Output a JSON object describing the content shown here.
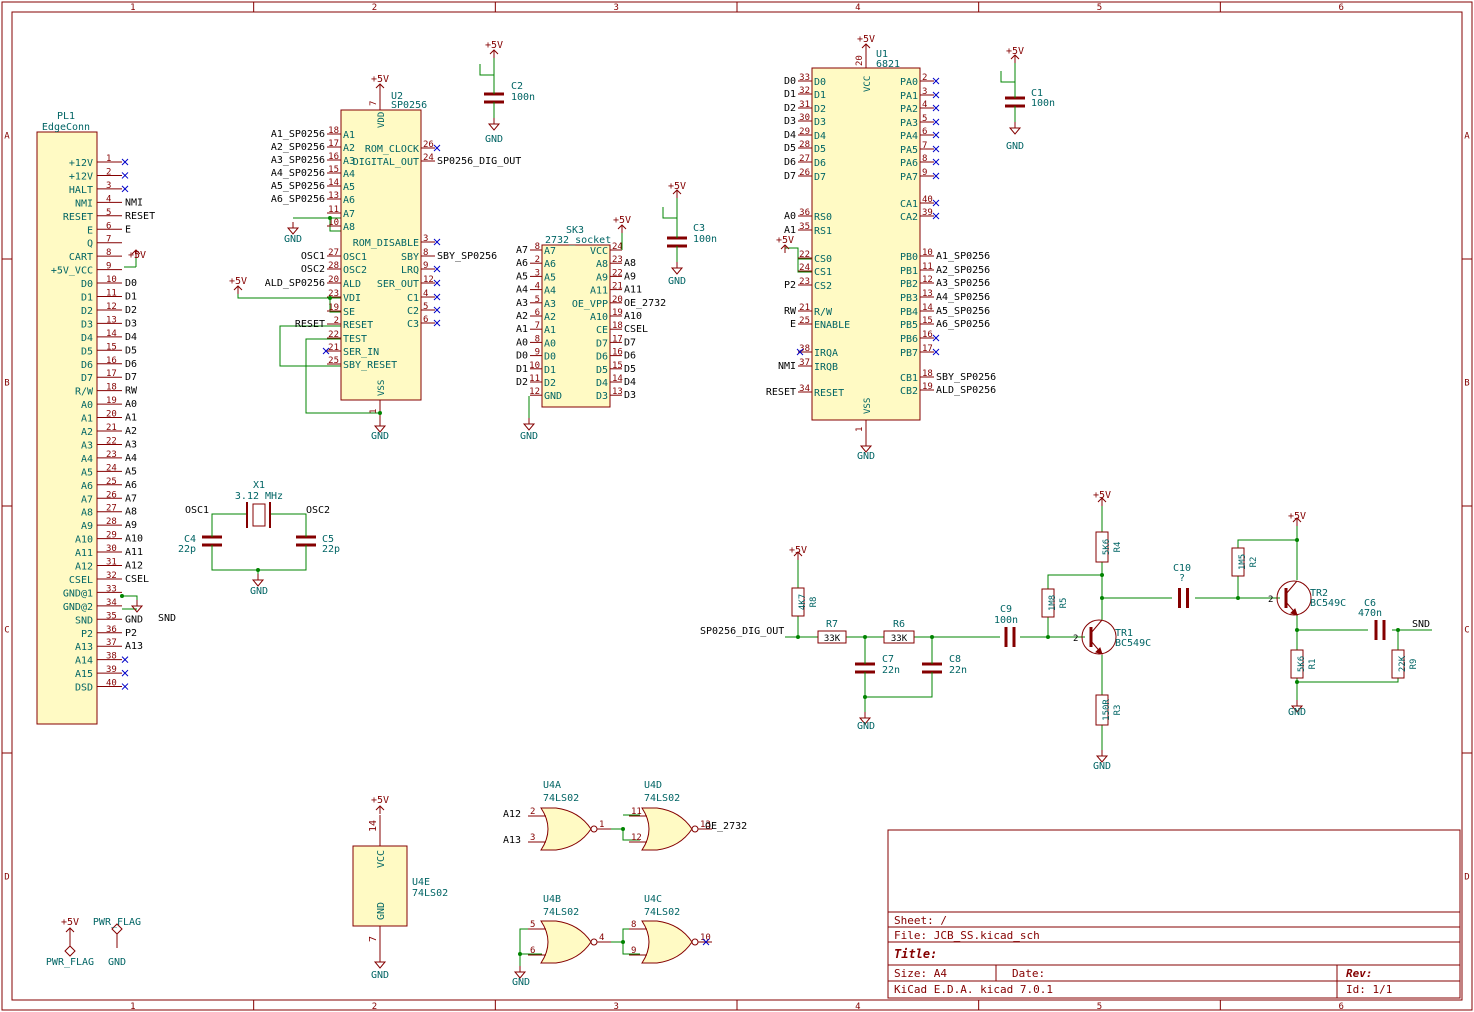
{
  "frame": {
    "col_labels": [
      "1",
      "2",
      "3",
      "4",
      "5",
      "6"
    ],
    "row_labels": [
      "A",
      "B",
      "C",
      "D"
    ]
  },
  "colors": {
    "frame": "#840000",
    "body": "#fffac4",
    "wire": "#008400",
    "text": "#000000",
    "power": "#840000",
    "ref": "#006464",
    "noconnect": "#0000c8"
  },
  "title_block": {
    "sheet": "Sheet: /",
    "file": "File: JCB_SS.kicad_sch",
    "title": "Title:",
    "size": "Size: A4",
    "date": "Date:",
    "rev": "Rev:",
    "kicad": "KiCad E.D.A.  kicad 7.0.1",
    "id": "Id: 1/1"
  },
  "pl1": {
    "ref": "PL1",
    "value": "EdgeConn",
    "pins": [
      {
        "num": "1",
        "name": "+12V",
        "net": ""
      },
      {
        "num": "2",
        "name": "+12V",
        "net": ""
      },
      {
        "num": "3",
        "name": "HALT",
        "net": ""
      },
      {
        "num": "4",
        "name": "NMI",
        "net": "NMI"
      },
      {
        "num": "5",
        "name": "RESET",
        "net": "RESET"
      },
      {
        "num": "6",
        "name": "E",
        "net": "E"
      },
      {
        "num": "7",
        "name": "Q",
        "net": ""
      },
      {
        "num": "8",
        "name": "CART",
        "net": ""
      },
      {
        "num": "9",
        "name": "+5V_VCC",
        "net": ""
      },
      {
        "num": "10",
        "name": "D0",
        "net": "D0"
      },
      {
        "num": "11",
        "name": "D1",
        "net": "D1"
      },
      {
        "num": "12",
        "name": "D2",
        "net": "D2"
      },
      {
        "num": "13",
        "name": "D3",
        "net": "D3"
      },
      {
        "num": "14",
        "name": "D4",
        "net": "D4"
      },
      {
        "num": "15",
        "name": "D5",
        "net": "D5"
      },
      {
        "num": "16",
        "name": "D6",
        "net": "D6"
      },
      {
        "num": "17",
        "name": "D7",
        "net": "D7"
      },
      {
        "num": "18",
        "name": "R/W",
        "net": "RW"
      },
      {
        "num": "19",
        "name": "A0",
        "net": "A0"
      },
      {
        "num": "20",
        "name": "A1",
        "net": "A1"
      },
      {
        "num": "21",
        "name": "A2",
        "net": "A2"
      },
      {
        "num": "22",
        "name": "A3",
        "net": "A3"
      },
      {
        "num": "23",
        "name": "A4",
        "net": "A4"
      },
      {
        "num": "24",
        "name": "A5",
        "net": "A5"
      },
      {
        "num": "25",
        "name": "A6",
        "net": "A6"
      },
      {
        "num": "26",
        "name": "A7",
        "net": "A7"
      },
      {
        "num": "27",
        "name": "A8",
        "net": "A8"
      },
      {
        "num": "28",
        "name": "A9",
        "net": "A9"
      },
      {
        "num": "29",
        "name": "A10",
        "net": "A10"
      },
      {
        "num": "30",
        "name": "A11",
        "net": "A11"
      },
      {
        "num": "31",
        "name": "A12",
        "net": "A12"
      },
      {
        "num": "32",
        "name": "CSEL",
        "net": "CSEL"
      },
      {
        "num": "33",
        "name": "GND@1",
        "net": ""
      },
      {
        "num": "34",
        "name": "GND@2",
        "net": ""
      },
      {
        "num": "35",
        "name": "SND",
        "net": "GND"
      },
      {
        "num": "36",
        "name": "P2",
        "net": "P2"
      },
      {
        "num": "37",
        "name": "A13",
        "net": "A13"
      },
      {
        "num": "38",
        "name": "A14",
        "net": ""
      },
      {
        "num": "39",
        "name": "A15",
        "net": ""
      },
      {
        "num": "40",
        "name": "DSD",
        "net": ""
      }
    ],
    "plus5v": "+5V",
    "snd": "SND"
  },
  "u2": {
    "ref": "U2",
    "value": "SP0256",
    "vdd": "VDD",
    "vss": "VSS",
    "left_pins": [
      {
        "num": "18",
        "name": "A1",
        "net": "A1_SP0256"
      },
      {
        "num": "17",
        "name": "A2",
        "net": "A2_SP0256"
      },
      {
        "num": "16",
        "name": "A3",
        "net": "A3_SP0256"
      },
      {
        "num": "15",
        "name": "A4",
        "net": "A4_SP0256"
      },
      {
        "num": "14",
        "name": "A5",
        "net": "A5_SP0256"
      },
      {
        "num": "13",
        "name": "A6",
        "net": "A6_SP0256"
      },
      {
        "num": "11",
        "name": "A7",
        "net": ""
      },
      {
        "num": "10",
        "name": "A8",
        "net": ""
      },
      {
        "num": "27",
        "name": "OSC1",
        "net": "OSC1"
      },
      {
        "num": "28",
        "name": "OSC2",
        "net": "OSC2"
      },
      {
        "num": "20",
        "name": "ALD",
        "net": "ALD_SP0256"
      },
      {
        "num": "23",
        "name": "VDI",
        "net": ""
      },
      {
        "num": "19",
        "name": "SE",
        "net": ""
      },
      {
        "num": "2",
        "name": "RESET",
        "net": "RESET"
      },
      {
        "num": "22",
        "name": "TEST",
        "net": ""
      },
      {
        "num": "21",
        "name": "SER_IN",
        "net": ""
      },
      {
        "num": "25",
        "name": "SBY_RESET",
        "net": ""
      }
    ],
    "right_pins": [
      {
        "num": "26",
        "name": "ROM_CLOCK",
        "net": ""
      },
      {
        "num": "24",
        "name": "DIGITAL_OUT",
        "net": "SP0256_DIG_OUT"
      },
      {
        "num": "3",
        "name": "ROM_DISABLE",
        "net": ""
      },
      {
        "num": "8",
        "name": "SBY",
        "net": "SBY_SP0256"
      },
      {
        "num": "9",
        "name": "LRQ",
        "net": ""
      },
      {
        "num": "12",
        "name": "SER_OUT",
        "net": ""
      },
      {
        "num": "4",
        "name": "C1",
        "net": ""
      },
      {
        "num": "5",
        "name": "C2",
        "net": ""
      },
      {
        "num": "6",
        "name": "C3",
        "net": ""
      }
    ],
    "pin_vdd": "7",
    "pin_vss": "1"
  },
  "sk3": {
    "ref": "SK3",
    "value": "2732_socket",
    "left_pins": [
      {
        "num": "8",
        "name": "A7",
        "net": "A7"
      },
      {
        "num": "2",
        "name": "A6",
        "net": "A6"
      },
      {
        "num": "3",
        "name": "A5",
        "net": "A5"
      },
      {
        "num": "4",
        "name": "A4",
        "net": "A4"
      },
      {
        "num": "5",
        "name": "A3",
        "net": "A3"
      },
      {
        "num": "6",
        "name": "A2",
        "net": "A2"
      },
      {
        "num": "7",
        "name": "A1",
        "net": "A1"
      },
      {
        "num": "8",
        "name": "A0",
        "net": "A0"
      },
      {
        "num": "9",
        "name": "D0",
        "net": "D0"
      },
      {
        "num": "10",
        "name": "D1",
        "net": "D1"
      },
      {
        "num": "11",
        "name": "D2",
        "net": "D2"
      },
      {
        "num": "12",
        "name": "GND",
        "net": ""
      }
    ],
    "right_pins": [
      {
        "num": "24",
        "name": "VCC",
        "net": ""
      },
      {
        "num": "23",
        "name": "A8",
        "net": "A8"
      },
      {
        "num": "22",
        "name": "A9",
        "net": "A9"
      },
      {
        "num": "21",
        "name": "A11",
        "net": "A11"
      },
      {
        "num": "20",
        "name": "OE_VPP",
        "net": "OE_2732"
      },
      {
        "num": "19",
        "name": "A10",
        "net": "A10"
      },
      {
        "num": "18",
        "name": "CE",
        "net": "CSEL"
      },
      {
        "num": "17",
        "name": "D7",
        "net": "D7"
      },
      {
        "num": "16",
        "name": "D6",
        "net": "D6"
      },
      {
        "num": "15",
        "name": "D5",
        "net": "D5"
      },
      {
        "num": "14",
        "name": "D4",
        "net": "D4"
      },
      {
        "num": "13",
        "name": "D3",
        "net": "D3"
      }
    ]
  },
  "u1": {
    "ref": "U1",
    "value": "6821",
    "vcc": "VCC",
    "vss": "VSS",
    "pin_vcc": "20",
    "pin_vss": "1",
    "left_pins": [
      {
        "num": "33",
        "name": "D0",
        "net": "D0"
      },
      {
        "num": "32",
        "name": "D1",
        "net": "D1"
      },
      {
        "num": "31",
        "name": "D2",
        "net": "D2"
      },
      {
        "num": "30",
        "name": "D3",
        "net": "D3"
      },
      {
        "num": "29",
        "name": "D4",
        "net": "D4"
      },
      {
        "num": "28",
        "name": "D5",
        "net": "D5"
      },
      {
        "num": "27",
        "name": "D6",
        "net": "D6"
      },
      {
        "num": "26",
        "name": "D7",
        "net": "D7"
      },
      {
        "num": "36",
        "name": "RS0",
        "net": "A0"
      },
      {
        "num": "35",
        "name": "RS1",
        "net": "A1"
      },
      {
        "num": "22",
        "name": "CS0",
        "net": ""
      },
      {
        "num": "24",
        "name": "CS1",
        "net": ""
      },
      {
        "num": "23",
        "name": "CS2",
        "net": "P2"
      },
      {
        "num": "21",
        "name": "R/W",
        "net": "RW"
      },
      {
        "num": "25",
        "name": "ENABLE",
        "net": "E"
      },
      {
        "num": "38",
        "name": "IRQA",
        "net": ""
      },
      {
        "num": "37",
        "name": "IRQB",
        "net": "NMI"
      },
      {
        "num": "34",
        "name": "RESET",
        "net": "RESET"
      }
    ],
    "right_pins": [
      {
        "num": "2",
        "name": "PA0",
        "net": ""
      },
      {
        "num": "3",
        "name": "PA1",
        "net": ""
      },
      {
        "num": "4",
        "name": "PA2",
        "net": ""
      },
      {
        "num": "5",
        "name": "PA3",
        "net": ""
      },
      {
        "num": "6",
        "name": "PA4",
        "net": ""
      },
      {
        "num": "7",
        "name": "PA5",
        "net": ""
      },
      {
        "num": "8",
        "name": "PA6",
        "net": ""
      },
      {
        "num": "9",
        "name": "PA7",
        "net": ""
      },
      {
        "num": "40",
        "name": "CA1",
        "net": ""
      },
      {
        "num": "39",
        "name": "CA2",
        "net": ""
      },
      {
        "num": "10",
        "name": "PB0",
        "net": "A1_SP0256"
      },
      {
        "num": "11",
        "name": "PB1",
        "net": "A2_SP0256"
      },
      {
        "num": "12",
        "name": "PB2",
        "net": "A3_SP0256"
      },
      {
        "num": "13",
        "name": "PB3",
        "net": "A4_SP0256"
      },
      {
        "num": "14",
        "name": "PB4",
        "net": "A5_SP0256"
      },
      {
        "num": "15",
        "name": "PB5",
        "net": "A6_SP0256"
      },
      {
        "num": "16",
        "name": "PB6",
        "net": ""
      },
      {
        "num": "17",
        "name": "PB7",
        "net": ""
      },
      {
        "num": "18",
        "name": "CB1",
        "net": "SBY_SP0256"
      },
      {
        "num": "19",
        "name": "CB2",
        "net": "ALD_SP0256"
      }
    ]
  },
  "caps": {
    "c1": {
      "ref": "C1",
      "value": "100n"
    },
    "c2": {
      "ref": "C2",
      "value": "100n"
    },
    "c3": {
      "ref": "C3",
      "value": "100n"
    },
    "c4": {
      "ref": "C4",
      "value": "22p"
    },
    "c5": {
      "ref": "C5",
      "value": "22p"
    },
    "c6": {
      "ref": "C6",
      "value": "470n"
    },
    "c7": {
      "ref": "C7",
      "value": "22n"
    },
    "c8": {
      "ref": "C8",
      "value": "22n"
    },
    "c9": {
      "ref": "C9",
      "value": "100n"
    },
    "c10": {
      "ref": "C10",
      "value": "?"
    }
  },
  "resistors": {
    "r1": {
      "ref": "R1",
      "value": "5K6"
    },
    "r2": {
      "ref": "R2",
      "value": "1M5"
    },
    "r3": {
      "ref": "R3",
      "value": "150R"
    },
    "r4": {
      "ref": "R4",
      "value": "5K6"
    },
    "r5": {
      "ref": "R5",
      "value": "1M8"
    },
    "r6": {
      "ref": "R6",
      "value": "33K"
    },
    "r7": {
      "ref": "R7",
      "value": "33K"
    },
    "r8": {
      "ref": "R8",
      "value": "4K7"
    },
    "r9": {
      "ref": "R9",
      "value": "22K"
    }
  },
  "transistors": {
    "tr1": {
      "ref": "TR1",
      "value": "BC549C"
    },
    "tr2": {
      "ref": "TR2",
      "value": "BC549C"
    }
  },
  "crystal": {
    "ref": "X1",
    "value": "3.12 MHz",
    "osc1": "OSC1",
    "osc2": "OSC2"
  },
  "gates": {
    "u4a": {
      "ref": "U4A",
      "value": "74LS02",
      "in1": "A12",
      "in2": "A13",
      "p1": "2",
      "p2": "3",
      "out": "1"
    },
    "u4d": {
      "ref": "U4D",
      "value": "74LS02",
      "p1": "11",
      "p2": "12",
      "out": "13",
      "net": "OE_2732"
    },
    "u4b": {
      "ref": "U4B",
      "value": "74LS02",
      "p1": "5",
      "p2": "6",
      "out": "4"
    },
    "u4c": {
      "ref": "U4C",
      "value": "74LS02",
      "p1": "8",
      "p2": "9",
      "out": "10"
    },
    "u4e": {
      "ref": "U4E",
      "value": "74LS02",
      "vcc": "VCC",
      "gnd": "GND",
      "pin_vcc": "14",
      "pin_gnd": "7"
    }
  },
  "power": {
    "plus5v": "+5V",
    "gnd": "GND",
    "pwr_flag": "PWR_FLAG"
  },
  "net_labels": {
    "sp0256_dig_out": "SP0256_DIG_OUT",
    "snd": "SND"
  }
}
